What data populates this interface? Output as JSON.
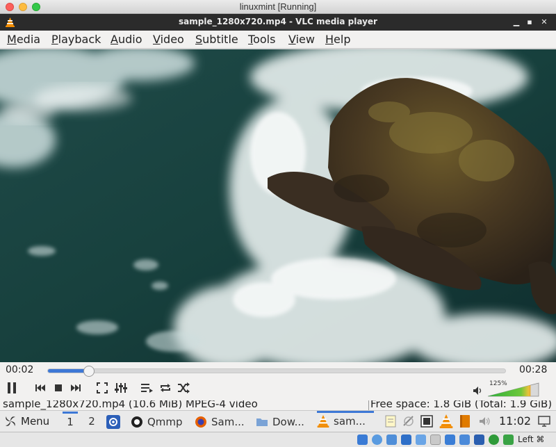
{
  "host_window": {
    "title": "linuxmint [Running]"
  },
  "vlc": {
    "title": "sample_1280x720.mp4 - VLC media player",
    "menu": [
      {
        "first": "M",
        "rest": "edia"
      },
      {
        "first": "P",
        "rest": "layback"
      },
      {
        "first": "A",
        "rest": "udio"
      },
      {
        "first": "V",
        "rest": "ideo"
      },
      {
        "first": "S",
        "rest": "ubtitle"
      },
      {
        "first": "T",
        "rest": "ools"
      },
      {
        "first": "V",
        "rest": "iew"
      },
      {
        "first": "H",
        "rest": "elp"
      }
    ],
    "playback": {
      "elapsed": "00:02",
      "total": "00:28",
      "progress": 0.09
    },
    "volume": {
      "percent_label": "125%",
      "level": 0.83
    },
    "status": {
      "file_info": "sample_1280x720.mp4  (10.6 MiB) MPEG-4 video",
      "free_space": "Free space: 1.8 GiB (Total: 1.9 GiB)"
    }
  },
  "taskbar": {
    "menu_label": "Menu",
    "workspaces": [
      "1",
      "2"
    ],
    "apps": [
      {
        "label": "Qmmp",
        "icon": "qmmp-icon"
      },
      {
        "label": "Sam...",
        "icon": "firefox-icon"
      },
      {
        "label": "Dow...",
        "icon": "folder-icon"
      },
      {
        "label": "sam...",
        "icon": "vlc-cone-icon"
      }
    ],
    "clock": "11:02"
  },
  "vbox": {
    "host_key": "Left ⌘"
  },
  "colors": {
    "accent": "#3d78d6",
    "vlc_orange": "#f28c00"
  }
}
